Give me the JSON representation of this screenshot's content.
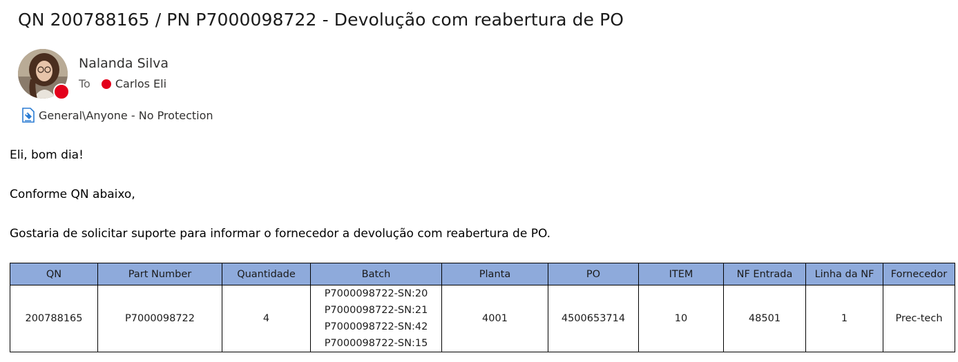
{
  "email": {
    "subject": "QN 200788165 / PN P7000098722 - Devolução com reabertura de PO",
    "sender": "Nalanda Silva",
    "to_label": "To",
    "recipient": "Carlos Eli",
    "sensitivity": "General\\Anyone - No Protection",
    "presence_color": "#e3001b",
    "icons": {
      "avatar": "avatar-photo",
      "sensitivity": "sensitivity-label-icon"
    }
  },
  "body": {
    "greeting": "Eli, bom dia!",
    "line2": "Conforme QN abaixo,",
    "line3": "Gostaria de solicitar suporte para informar o fornecedor a devolução com reabertura de PO."
  },
  "table": {
    "header_color": "#8eaadb",
    "headers": [
      "QN",
      "Part Number",
      "Quantidade",
      "Batch",
      "Planta",
      "PO",
      "ITEM",
      "NF Entrada",
      "Linha da NF",
      "Fornecedor"
    ],
    "row": {
      "qn": "200788165",
      "part_number": "P7000098722",
      "quantidade": "4",
      "batch": [
        "P7000098722-SN:20",
        "P7000098722-SN:21",
        "P7000098722-SN:42",
        "P7000098722-SN:15"
      ],
      "planta": "4001",
      "po": "4500653714",
      "item": "10",
      "nf_entrada": "48501",
      "linha_nf": "1",
      "fornecedor": "Prec-tech"
    }
  }
}
